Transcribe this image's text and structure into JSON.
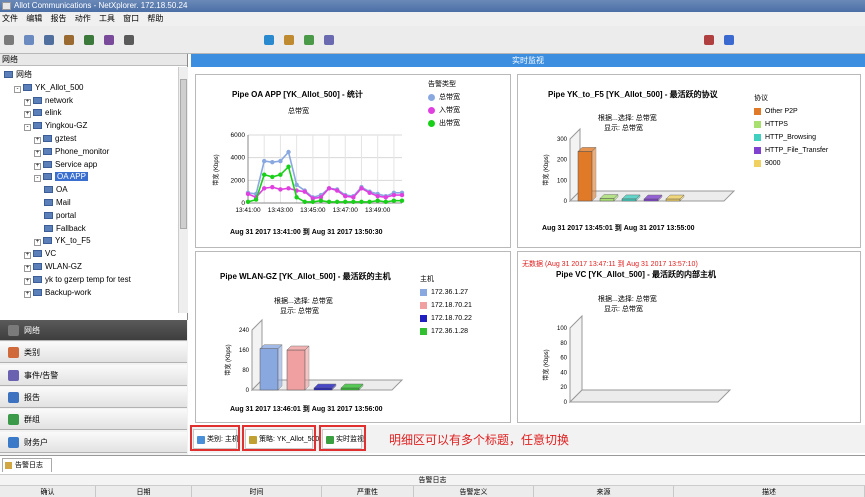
{
  "window": {
    "title": "Allot Communications - NetXplorer. 172.18.50.24"
  },
  "menu": [
    "文件",
    "编辑",
    "报告",
    "动作",
    "工具",
    "窗口",
    "帮助"
  ],
  "toolbar_icons": [
    "new-icon",
    "open-icon",
    "save-icon",
    "cut-icon",
    "copy-icon",
    "paste-icon",
    "print-icon",
    "refresh-icon",
    "filter-icon",
    "chart-icon",
    "table-icon",
    "user-icon",
    "help-icon"
  ],
  "left": {
    "tree_header": "网络",
    "tree": [
      {
        "label": "网络",
        "level": 0,
        "icon": "network-icon",
        "exp": ""
      },
      {
        "label": "YK_Allot_500",
        "level": 1,
        "icon": "device-icon",
        "exp": "-"
      },
      {
        "label": "network",
        "level": 2,
        "icon": "folder-icon",
        "exp": "+"
      },
      {
        "label": "elink",
        "level": 2,
        "icon": "folder-icon",
        "exp": "+"
      },
      {
        "label": "Yingkou-GZ",
        "level": 2,
        "icon": "folder-icon",
        "exp": "-"
      },
      {
        "label": "gztest",
        "level": 3,
        "icon": "pipe-icon",
        "exp": "+"
      },
      {
        "label": "Phone_monitor",
        "level": 3,
        "icon": "pipe-icon",
        "exp": "+"
      },
      {
        "label": "Service app",
        "level": 3,
        "icon": "pipe-icon",
        "exp": "+"
      },
      {
        "label": "OA APP",
        "level": 3,
        "icon": "pipe-icon",
        "exp": "-",
        "selected": true
      },
      {
        "label": "OA",
        "level": 4,
        "icon": "vc-icon",
        "exp": ""
      },
      {
        "label": "Mail",
        "level": 4,
        "icon": "vc-icon",
        "exp": ""
      },
      {
        "label": "portal",
        "level": 4,
        "icon": "vc-icon",
        "exp": ""
      },
      {
        "label": "Fallback",
        "level": 4,
        "icon": "vc-icon",
        "exp": ""
      },
      {
        "label": "YK_to_F5",
        "level": 3,
        "icon": "pipe-icon",
        "exp": "+"
      },
      {
        "label": "VC",
        "level": 2,
        "icon": "folder-icon",
        "exp": "+"
      },
      {
        "label": "WLAN-GZ",
        "level": 2,
        "icon": "folder-icon",
        "exp": "+"
      },
      {
        "label": "yk to gzerp temp for test",
        "level": 2,
        "icon": "folder-icon",
        "exp": "+"
      },
      {
        "label": "Backup-work",
        "level": 2,
        "icon": "folder-icon",
        "exp": "+"
      }
    ],
    "nav": [
      {
        "label": "网络",
        "icon": "network-icon",
        "color": "#7a7a7a",
        "active": true
      },
      {
        "label": "类别",
        "icon": "category-icon",
        "color": "#d06a3a"
      },
      {
        "label": "事件/告警",
        "icon": "alarm-icon",
        "color": "#6a62b0"
      },
      {
        "label": "报告",
        "icon": "report-icon",
        "color": "#3c72bf"
      },
      {
        "label": "群组",
        "icon": "group-icon",
        "color": "#3a9a4a"
      },
      {
        "label": "财务户",
        "icon": "account-icon",
        "color": "#3a7ac9"
      }
    ]
  },
  "main": {
    "header": "实时监视",
    "charts": {
      "c1": {
        "title": "Pipe OA APP [YK_Allot_500] - 统计",
        "subtitle": "总带宽",
        "ylabel": "带宽 (Kbps)",
        "xticks": [
          "13:41:00",
          "13:43:00",
          "13:45:00",
          "13:47:00",
          "13:49:00"
        ],
        "yticks": [
          "6000",
          "4000",
          "2000",
          "0"
        ],
        "footer": "Aug 31 2017   13:41:00  到  Aug 31 2017   13:50:30",
        "legend_title": "告警类型",
        "legend": [
          {
            "label": "总带宽",
            "color": "#8aa8e0"
          },
          {
            "label": "入带宽",
            "color": "#e040e0"
          },
          {
            "label": "出带宽",
            "color": "#18d018"
          }
        ]
      },
      "c2": {
        "title": "Pipe YK_to_F5 [YK_Allot_500] - 最活跃的协议",
        "subtitle1": "根据...选择: 总带宽",
        "subtitle2": "显示: 总带宽",
        "ylabel": "带宽 (Kbps)",
        "yticks": [
          "300",
          "200",
          "100",
          "0"
        ],
        "footer": "Aug 31 2017   13:45:01  到  Aug 31 2017   13:55:00",
        "legend_title": "协议",
        "legend": [
          {
            "label": "Other P2P",
            "color": "#e07a28"
          },
          {
            "label": "HTTPS",
            "color": "#a8e070"
          },
          {
            "label": "HTTP_Browsing",
            "color": "#40d0c0"
          },
          {
            "label": "HTTP_File_Transfer",
            "color": "#8040d0"
          },
          {
            "label": "9000",
            "color": "#f0d060"
          }
        ]
      },
      "c3": {
        "title": "Pipe WLAN-GZ [YK_Allot_500] - 最活跃的主机",
        "subtitle1": "根据...选择: 总带宽",
        "subtitle2": "显示: 总带宽",
        "ylabel": "带宽 (Kbps)",
        "yticks": [
          "240",
          "160",
          "80",
          "0"
        ],
        "footer": "Aug 31 2017   13:46:01  到  Aug 31 2017   13:56:00",
        "legend_title": "主机",
        "legend": [
          {
            "label": "172.36.1.27",
            "color": "#8aa8e0"
          },
          {
            "label": "172.18.70.21",
            "color": "#f0a0a0"
          },
          {
            "label": "172.18.70.22",
            "color": "#2020c0"
          },
          {
            "label": "172.36.1.28",
            "color": "#30c030"
          }
        ]
      },
      "c4": {
        "notice": "无数据 (Aug 31 2017   13:47:11  到  Aug 31 2017   13:57:10)",
        "title": "Pipe VC [YK_Allot_500] - 最活跃的内部主机",
        "subtitle1": "根据...选择: 总带宽",
        "subtitle2": "显示: 总带宽",
        "ylabel": "带宽 (Kbps)",
        "yticks": [
          "100",
          "80",
          "60",
          "40",
          "20",
          "0"
        ]
      }
    }
  },
  "chart_data": [
    {
      "type": "line",
      "title": "Pipe OA APP [YK_Allot_500] - 统计",
      "xlabel": "",
      "ylabel": "带宽 (Kbps)",
      "ylim": [
        0,
        6000
      ],
      "x": [
        "13:41:00",
        "13:41:30",
        "13:42:00",
        "13:42:30",
        "13:43:00",
        "13:43:30",
        "13:44:00",
        "13:44:30",
        "13:45:00",
        "13:45:30",
        "13:46:00",
        "13:46:30",
        "13:47:00",
        "13:47:30",
        "13:48:00",
        "13:48:30",
        "13:49:00",
        "13:49:30",
        "13:50:00",
        "13:50:30"
      ],
      "series": [
        {
          "name": "总带宽",
          "color": "#8aa8e0",
          "values": [
            900,
            800,
            3700,
            3600,
            3700,
            4500,
            1600,
            1100,
            500,
            700,
            1300,
            1200,
            700,
            600,
            1400,
            1000,
            800,
            600,
            900,
            900
          ]
        },
        {
          "name": "入带宽",
          "color": "#e040e0",
          "values": [
            800,
            500,
            1300,
            1400,
            1200,
            1300,
            1100,
            1000,
            400,
            500,
            1300,
            1100,
            600,
            500,
            1300,
            900,
            600,
            500,
            700,
            700
          ]
        },
        {
          "name": "出带宽",
          "color": "#18d018",
          "values": [
            100,
            300,
            2500,
            2300,
            2500,
            3200,
            500,
            100,
            100,
            200,
            100,
            100,
            100,
            100,
            100,
            100,
            200,
            100,
            200,
            200
          ]
        }
      ],
      "grid": true,
      "legend": "right"
    },
    {
      "type": "bar",
      "title": "Pipe YK_to_F5 [YK_Allot_500] - 最活跃的协议",
      "ylabel": "带宽 (Kbps)",
      "ylim": [
        0,
        300
      ],
      "series": [
        {
          "name": "Other P2P",
          "color": "#e07a28",
          "values": [
            240
          ]
        },
        {
          "name": "HTTPS",
          "color": "#a8e070",
          "values": [
            12
          ]
        },
        {
          "name": "HTTP_Browsing",
          "color": "#40d0c0",
          "values": [
            10
          ]
        },
        {
          "name": "HTTP_File_Transfer",
          "color": "#8040d0",
          "values": [
            8
          ]
        },
        {
          "name": "9000",
          "color": "#f0d060",
          "values": [
            6
          ]
        }
      ],
      "legend": "right"
    },
    {
      "type": "bar",
      "title": "Pipe WLAN-GZ [YK_Allot_500] - 最活跃的主机",
      "ylabel": "带宽 (Kbps)",
      "ylim": [
        0,
        240
      ],
      "series": [
        {
          "name": "172.36.1.27",
          "color": "#8aa8e0",
          "values": [
            165
          ]
        },
        {
          "name": "172.18.70.21",
          "color": "#f0a0a0",
          "values": [
            160
          ]
        },
        {
          "name": "172.18.70.22",
          "color": "#2020c0",
          "values": [
            5
          ]
        },
        {
          "name": "172.36.1.28",
          "color": "#30c030",
          "values": [
            4
          ]
        }
      ],
      "legend": "right"
    },
    {
      "type": "bar",
      "title": "Pipe VC [YK_Allot_500] - 最活跃的内部主机",
      "ylabel": "带宽 (Kbps)",
      "ylim": [
        0,
        100
      ],
      "series": []
    }
  ],
  "bottom_tabs": [
    {
      "label": "类别: 主机",
      "icon": "category-icon",
      "color": "#4a90d8"
    },
    {
      "label": "策略: YK_Allot_500",
      "icon": "policy-icon",
      "color": "#c0a030"
    },
    {
      "label": "实时监视",
      "icon": "monitor-icon",
      "color": "#3aa040"
    }
  ],
  "annotation": "明细区可以有多个标题，任意切换",
  "alarm": {
    "tab": "告警日志",
    "title": "告警日志",
    "columns": [
      "确认",
      "日期",
      "时间",
      "严重性",
      "告警定义",
      "来源",
      "描述"
    ]
  }
}
